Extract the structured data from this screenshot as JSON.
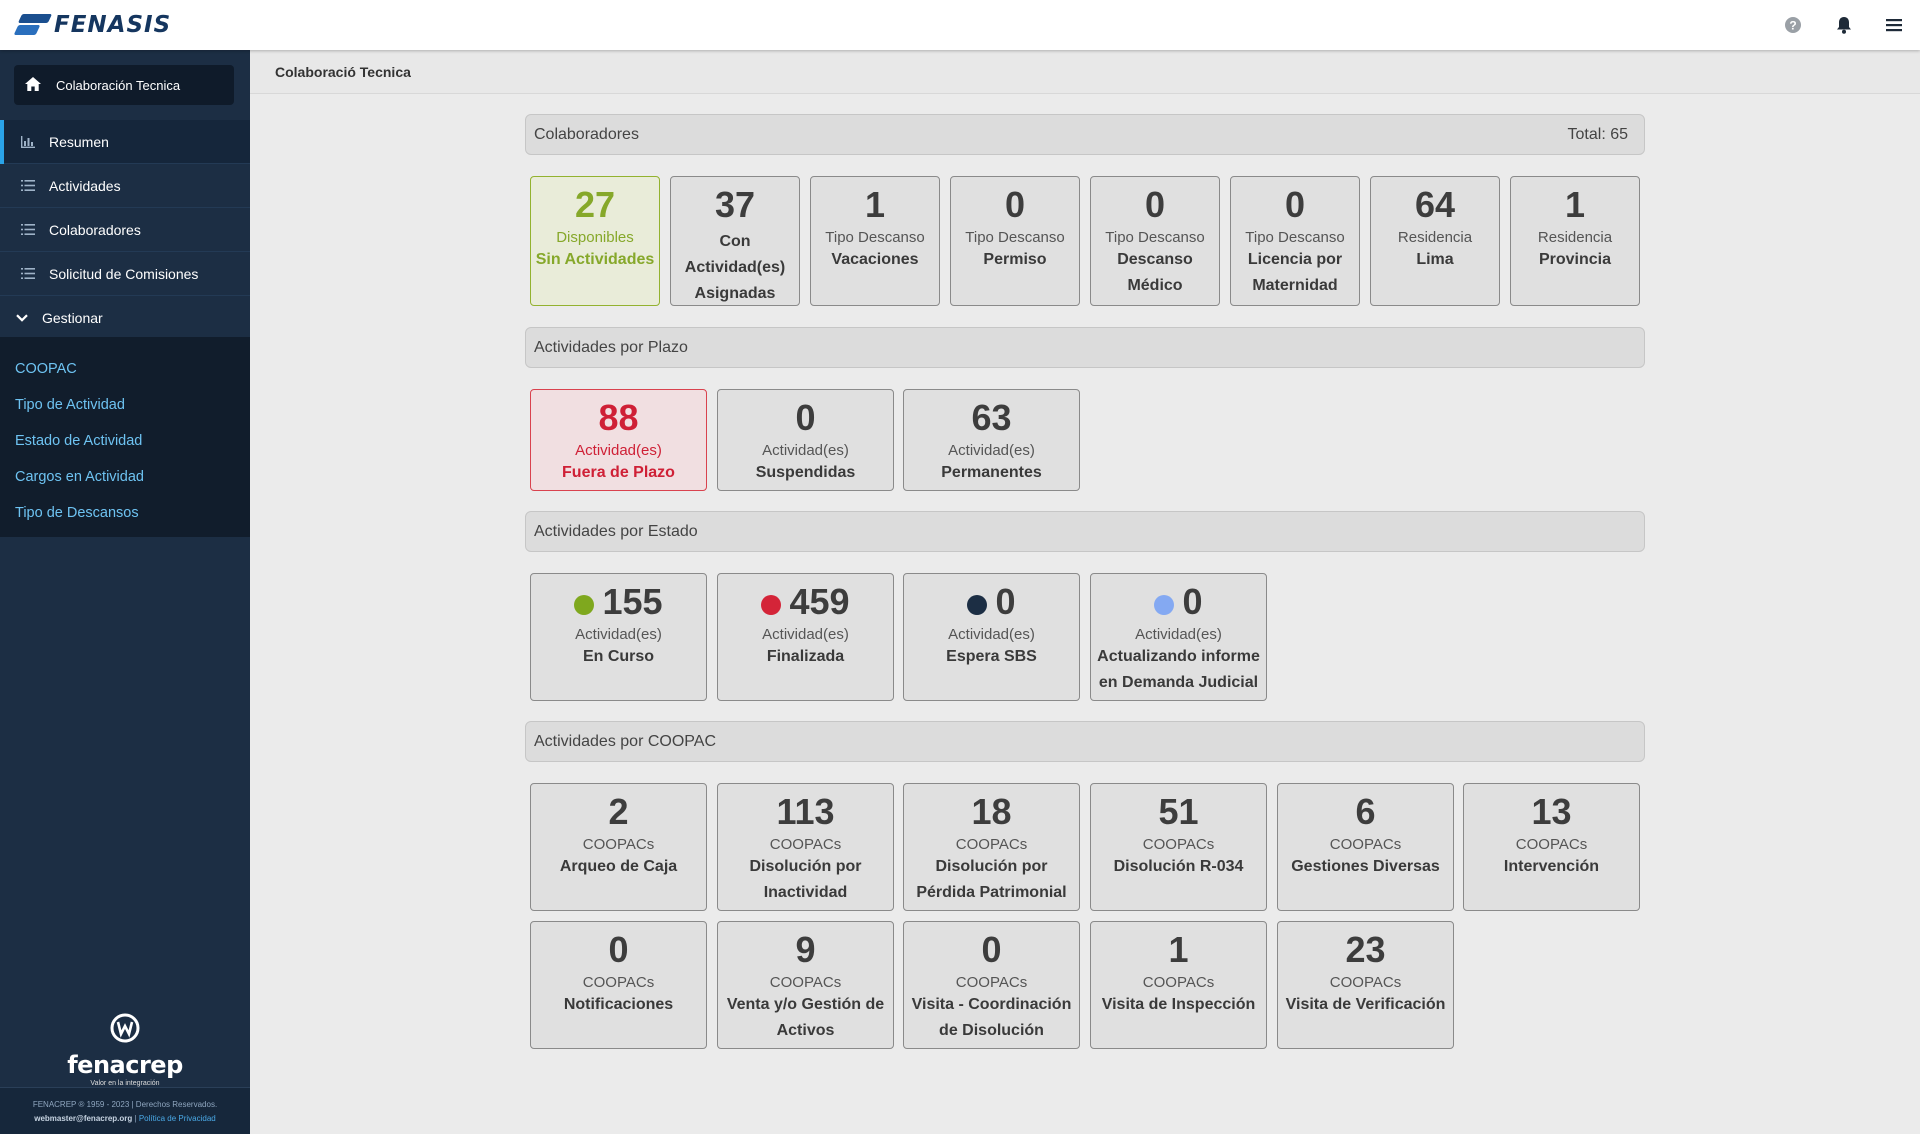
{
  "app": {
    "logo_text": "FENASIS",
    "breadcrumb": "Colaboració Tecnica"
  },
  "topbar": {
    "icons": [
      "help-icon",
      "bell-icon",
      "hamburger-icon"
    ]
  },
  "sidebar": {
    "header_label": "Colaboración Tecnica",
    "items": [
      {
        "label": "Resumen",
        "icon": "chart-icon",
        "active": true
      },
      {
        "label": "Actividades",
        "icon": "list-icon"
      },
      {
        "label": "Colaboradores",
        "icon": "list-icon"
      },
      {
        "label": "Solicitud de Comisiones",
        "icon": "list-icon"
      }
    ],
    "gestionar_label": "Gestionar",
    "gestionar_items": [
      "COOPAC",
      "Tipo de Actividad",
      "Estado de Actividad",
      "Cargos en Actividad",
      "Tipo de Descansos"
    ],
    "brand_name": "fenacrep",
    "brand_tagline": "Valor en la integración",
    "footer_line1": "FENACREP ® 1959 - 2023 | Derechos Reservados.",
    "footer_email": "webmaster@fenacrep.org",
    "footer_separator": "|",
    "footer_link": "Política de Privacidad"
  },
  "colaboradores": {
    "title": "Colaboradores",
    "total": "Total: 65",
    "cards": [
      {
        "value": "27",
        "line1": "Disponibles",
        "line2": "Sin Actividades",
        "style": "green"
      },
      {
        "value": "37",
        "line1": "",
        "line2": "Con Actividad(es) Asignadas"
      },
      {
        "value": "1",
        "line1": "Tipo Descanso",
        "line2": "Vacaciones"
      },
      {
        "value": "0",
        "line1": "Tipo Descanso",
        "line2": "Permiso"
      },
      {
        "value": "0",
        "line1": "Tipo Descanso",
        "line2": "Descanso Médico"
      },
      {
        "value": "0",
        "line1": "Tipo Descanso",
        "line2": "Licencia por Maternidad"
      },
      {
        "value": "64",
        "line1": "Residencia",
        "line2": "Lima"
      },
      {
        "value": "1",
        "line1": "Residencia",
        "line2": "Provincia"
      }
    ]
  },
  "plazo": {
    "title": "Actividades por Plazo",
    "cards": [
      {
        "value": "88",
        "line1": "Actividad(es)",
        "line2": "Fuera de Plazo",
        "style": "red"
      },
      {
        "value": "0",
        "line1": "Actividad(es)",
        "line2": "Suspendidas"
      },
      {
        "value": "63",
        "line1": "Actividad(es)",
        "line2": "Permanentes"
      }
    ]
  },
  "estado": {
    "title": "Actividades por Estado",
    "cards": [
      {
        "value": "155",
        "line1": "Actividad(es)",
        "line2": "En Curso",
        "dot": "#7fa81e"
      },
      {
        "value": "459",
        "line1": "Actividad(es)",
        "line2": "Finalizada",
        "dot": "#d42438"
      },
      {
        "value": "0",
        "line1": "Actividad(es)",
        "line2": "Espera SBS",
        "dot": "#1c2e44"
      },
      {
        "value": "0",
        "line1": "Actividad(es)",
        "line2": "Actualizando informe en Demanda Judicial",
        "dot": "#84a9f2"
      }
    ]
  },
  "coopac": {
    "title": "Actividades por COOPAC",
    "cards": [
      {
        "value": "2",
        "line1": "COOPACs",
        "line2": "Arqueo de Caja"
      },
      {
        "value": "113",
        "line1": "COOPACs",
        "line2": "Disolución por Inactividad"
      },
      {
        "value": "18",
        "line1": "COOPACs",
        "line2": "Disolución por Pérdida Patrimonial"
      },
      {
        "value": "51",
        "line1": "COOPACs",
        "line2": "Disolución R-034"
      },
      {
        "value": "6",
        "line1": "COOPACs",
        "line2": "Gestiones Diversas"
      },
      {
        "value": "13",
        "line1": "COOPACs",
        "line2": "Intervención"
      },
      {
        "value": "0",
        "line1": "COOPACs",
        "line2": "Notificaciones"
      },
      {
        "value": "9",
        "line1": "COOPACs",
        "line2": "Venta y/o Gestión de Activos"
      },
      {
        "value": "0",
        "line1": "COOPACs",
        "line2": "Visita - Coordinación de Disolución"
      },
      {
        "value": "1",
        "line1": "COOPACs",
        "line2": "Visita de Inspección"
      },
      {
        "value": "23",
        "line1": "COOPACs",
        "line2": "Visita de Verificación"
      }
    ]
  }
}
